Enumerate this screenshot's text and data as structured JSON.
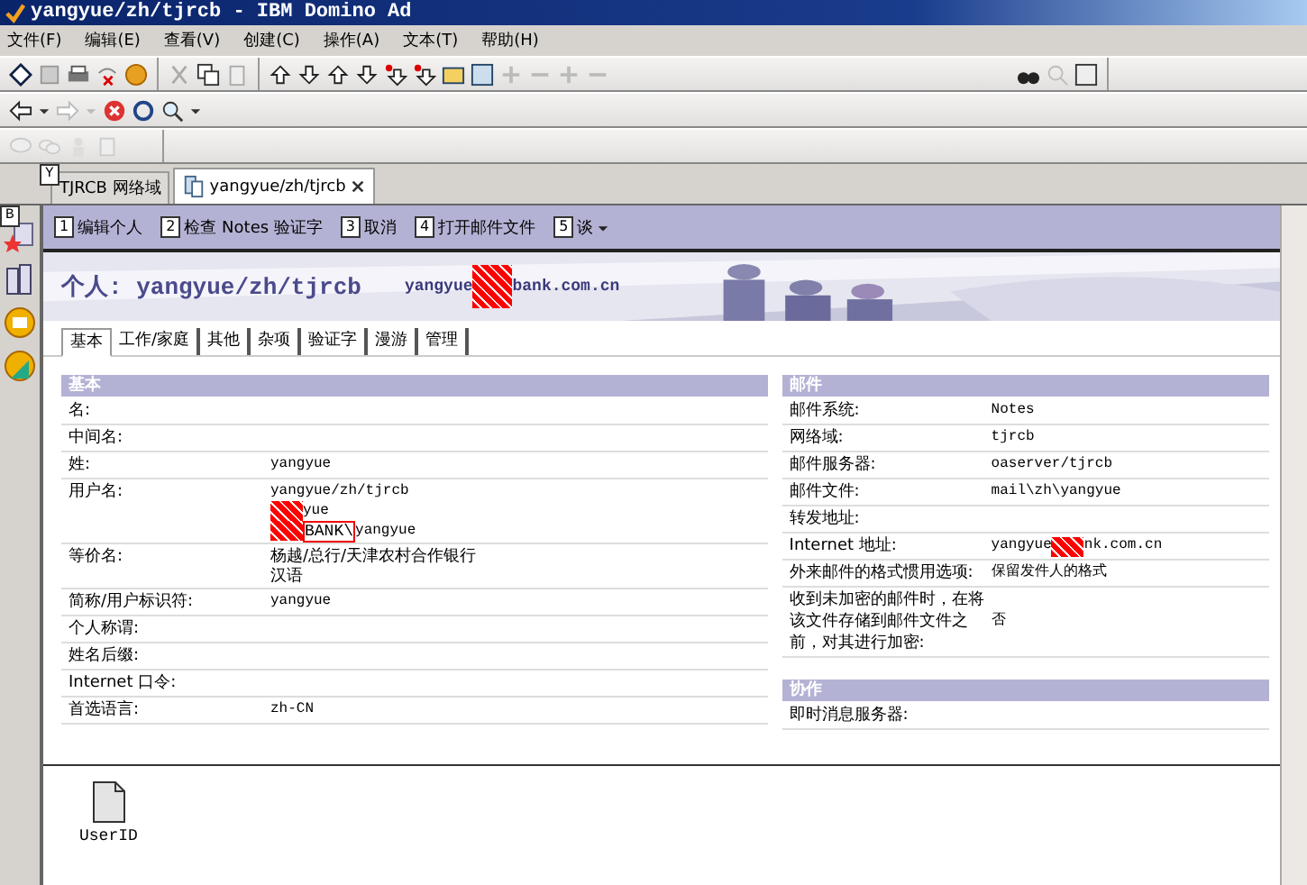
{
  "window": {
    "title": "yangyue/zh/tjrcb - IBM Domino Ad"
  },
  "menu": [
    "文件(F)",
    "编辑(E)",
    "查看(V)",
    "创建(C)",
    "操作(A)",
    "文本(T)",
    "帮助(H)"
  ],
  "doc_tabs": [
    {
      "label": "TJRCB 网络域",
      "selected": false,
      "closable": false
    },
    {
      "label": "yangyue/zh/tjrcb",
      "selected": true,
      "closable": true
    }
  ],
  "tab_hint": "Y",
  "side_hint": "B",
  "actions": [
    {
      "key": "1",
      "label": "编辑个人"
    },
    {
      "key": "2",
      "label": "检查 Notes 验证字"
    },
    {
      "key": "3",
      "label": "取消"
    },
    {
      "key": "4",
      "label": "打开邮件文件"
    },
    {
      "key": "5",
      "label": "谈",
      "dropdown": true
    }
  ],
  "header": {
    "title": "个人: yangyue/zh/tjrcb",
    "email_before": "yangyue",
    "email_after": "bank.com.cn"
  },
  "form_tabs": [
    {
      "label": "基本",
      "selected": true
    },
    {
      "label": "工作/家庭",
      "selected": false
    },
    {
      "label": "其他",
      "selected": false
    },
    {
      "label": "杂项",
      "selected": false
    },
    {
      "label": "验证字",
      "selected": false
    },
    {
      "label": "漫游",
      "selected": false
    },
    {
      "label": "管理",
      "selected": false
    }
  ],
  "basics": {
    "heading": "基本",
    "fields": [
      {
        "label": "名:"
      },
      {
        "label": "中间名:"
      },
      {
        "label": "姓:",
        "lines": [
          {
            "text": "yangyue"
          }
        ]
      },
      {
        "label": "用户名:",
        "lines": [
          {
            "text": "yangyue/zh/tjrcb"
          },
          {
            "text": "yue",
            "redacted": true
          },
          {
            "text": "yangyue",
            "redacted": true,
            "boxed": "BANK\\"
          }
        ]
      },
      {
        "label": "等价名:",
        "lines": [
          {
            "text": "杨越/总行/天津农村合作银行"
          },
          {
            "text": "汉语"
          }
        ]
      },
      {
        "label": "简称/用户标识符:",
        "lines": [
          {
            "text": "yangyue"
          }
        ]
      },
      {
        "label": "个人称谓:"
      },
      {
        "label": "姓名后缀:"
      },
      {
        "label": "Internet 口令:"
      },
      {
        "label": "首选语言:",
        "lines": [
          {
            "text": "zh-CN"
          }
        ]
      }
    ]
  },
  "mail": {
    "heading": "邮件",
    "fields": [
      {
        "label": "邮件系统:",
        "value": "Notes"
      },
      {
        "label": "网络域:",
        "value": "tjrcb"
      },
      {
        "label": "邮件服务器:",
        "value": "oaserver/tjrcb"
      },
      {
        "label": "邮件文件:",
        "value": "mail\\zh\\yangyue"
      },
      {
        "label": "转发地址:"
      },
      {
        "label": "Internet 地址:",
        "value": "yangyue",
        "value_after": "nk.com.cn"
      },
      {
        "label": "外来邮件的格式惯用选项:",
        "value": "保留发件人的格式"
      },
      {
        "label": "收到未加密的邮件时，在将该文件存储到邮件文件之前，对其进行加密:",
        "value": "否"
      }
    ]
  },
  "collab": {
    "heading": "协作",
    "fields": [
      {
        "label": "即时消息服务器:"
      }
    ]
  },
  "attachments": [
    {
      "label": "UserID"
    }
  ]
}
